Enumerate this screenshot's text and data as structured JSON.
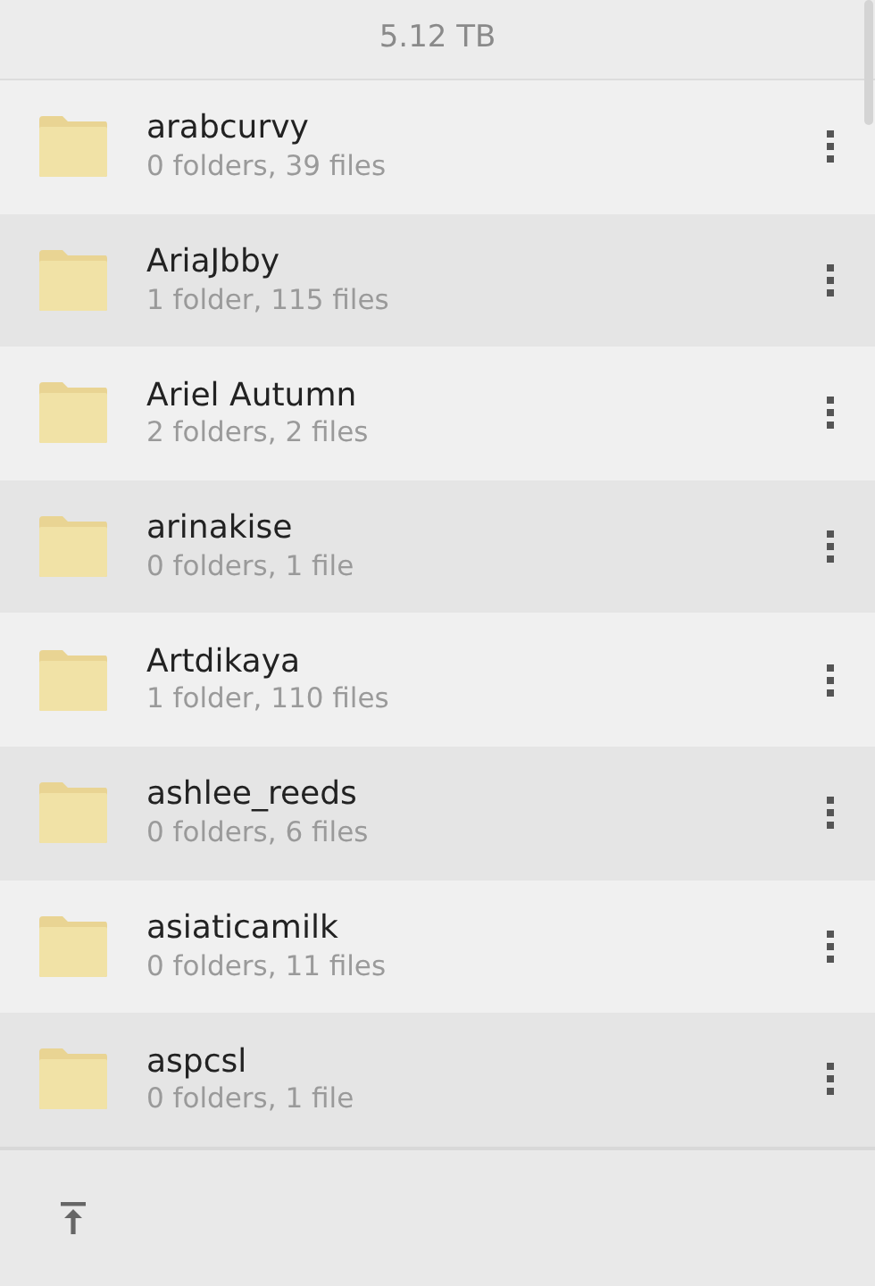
{
  "header": {
    "storage": "5.12 TB"
  },
  "folders": [
    {
      "name": "arabcurvy",
      "details": "0 folders, 39 files"
    },
    {
      "name": "AriaJbby",
      "details": "1 folder, 115 files"
    },
    {
      "name": "Ariel Autumn",
      "details": "2 folders, 2 files"
    },
    {
      "name": "arinakise",
      "details": "0 folders, 1 file"
    },
    {
      "name": "Artdikaya",
      "details": "1 folder, 110 files"
    },
    {
      "name": "ashlee_reeds",
      "details": "0 folders, 6 files"
    },
    {
      "name": "asiaticamilk",
      "details": "0 folders, 11 files"
    },
    {
      "name": "aspcsl",
      "details": "0 folders, 1 file"
    }
  ]
}
